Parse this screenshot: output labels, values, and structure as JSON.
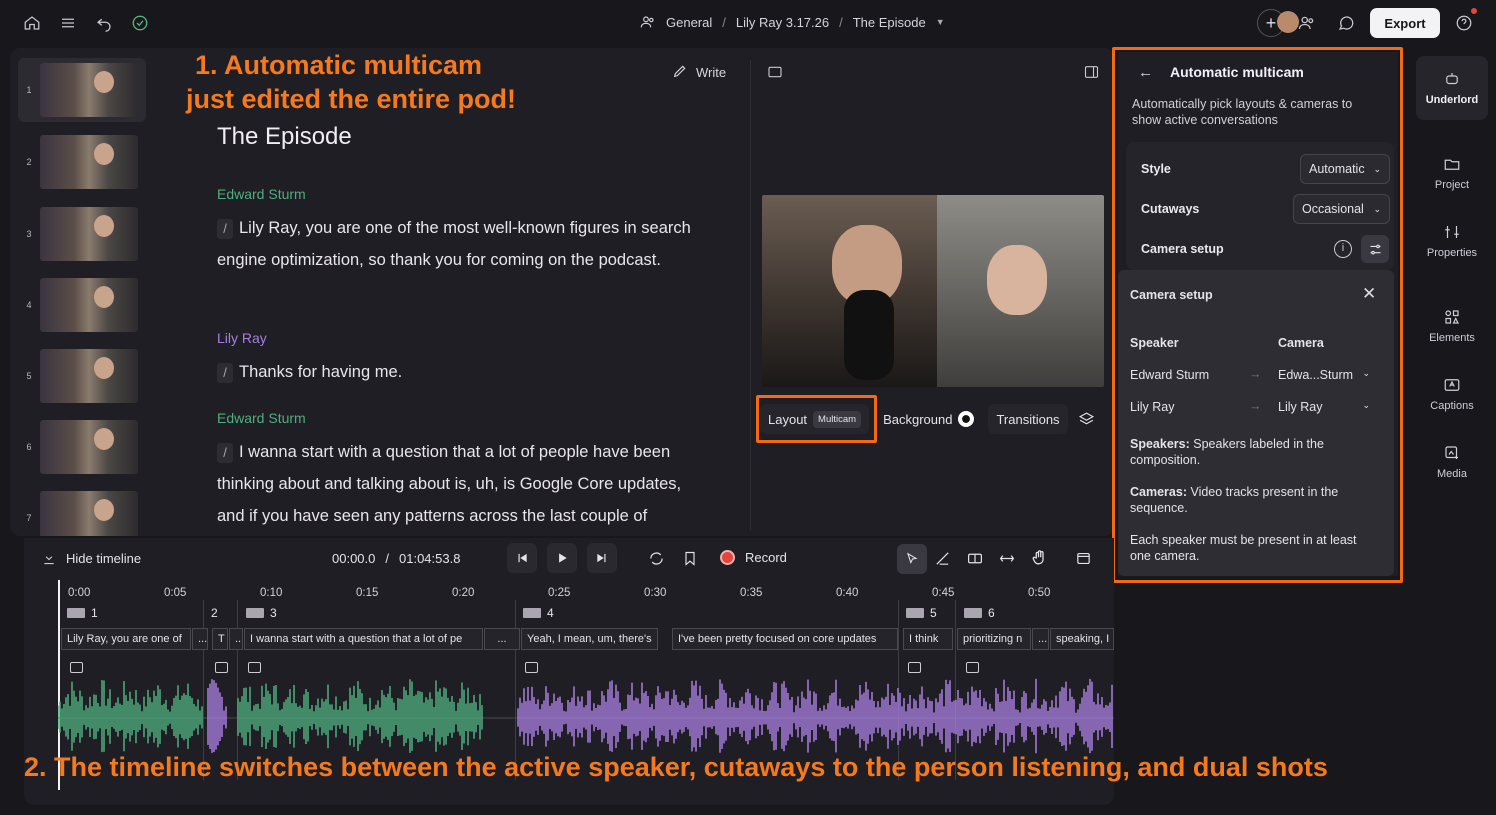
{
  "topbar": {
    "breadcrumb": [
      "General",
      "Lily Ray 3.17.26",
      "The Episode"
    ],
    "export_label": "Export"
  },
  "annotations": {
    "a1_line1": "1. Automatic multicam",
    "a1_line2": "just edited the entire pod!",
    "a2": "2. The timeline switches between the active speaker, cutaways to the person listening, and dual shots"
  },
  "thumbnails": [
    "1",
    "2",
    "3",
    "4",
    "5",
    "6",
    "7"
  ],
  "document": {
    "title": "The Episode",
    "write_label": "Write",
    "blocks": [
      {
        "speaker": "Edward Sturm",
        "text": "Lily Ray, you are one of the most well-known figures in search engine optimization, so thank you for coming on the podcast."
      },
      {
        "speaker": "Lily Ray",
        "text": "Thanks for having me."
      },
      {
        "speaker": "Edward Sturm",
        "text": "I wanna start with a question that a lot of people have been thinking about and talking about is, uh, is Google Core updates, and if you have seen any patterns across the last couple of"
      }
    ]
  },
  "layoutbar": {
    "layout": "Layout",
    "layout_badge": "Multicam",
    "background": "Background",
    "transitions": "Transitions"
  },
  "multicam": {
    "title": "Automatic multicam",
    "description": "Automatically pick layouts & cameras to show active conversations",
    "style_label": "Style",
    "style_value": "Automatic",
    "cutaways_label": "Cutaways",
    "cutaways_value": "Occasional",
    "camera_setup_label": "Camera setup"
  },
  "camera_setup": {
    "title": "Camera setup",
    "speaker_header": "Speaker",
    "camera_header": "Camera",
    "rows": [
      {
        "speaker": "Edward Sturm",
        "camera": "Edwa...Sturm"
      },
      {
        "speaker": "Lily Ray",
        "camera": "Lily Ray"
      }
    ],
    "speakers_title": "Speakers:",
    "speakers_note": "Speakers labeled in the composition.",
    "cameras_title": "Cameras:",
    "cameras_note": "Video tracks present in the sequence.",
    "footer_note": "Each speaker must be present in at least one camera."
  },
  "rail": [
    "Underlord",
    "Project",
    "Properties",
    "Elements",
    "Captions",
    "Media"
  ],
  "timeline": {
    "hide_label": "Hide timeline",
    "current_time": "00:00.0",
    "time_sep": "/",
    "total_time": "01:04:53.8",
    "record_label": "Record",
    "ticks": [
      "0:00",
      "0:05",
      "0:10",
      "0:15",
      "0:20",
      "0:25",
      "0:30",
      "0:35",
      "0:40",
      "0:45",
      "0:50"
    ],
    "clips": [
      "1",
      "2",
      "3",
      "4",
      "5",
      "6"
    ],
    "captions": [
      "Lily Ray, you are one of",
      "...",
      "T",
      "..",
      "I wanna start with a question that a lot of pe",
      "...",
      "Yeah, I mean, um, there's",
      "I've been pretty focused on core updates",
      "I think",
      "prioritizing n",
      "...",
      "speaking, I"
    ]
  },
  "colors": {
    "accent_orange": "#f57a1e",
    "speaker_edward": "#4fae7e",
    "speaker_lily": "#a87fe0"
  }
}
